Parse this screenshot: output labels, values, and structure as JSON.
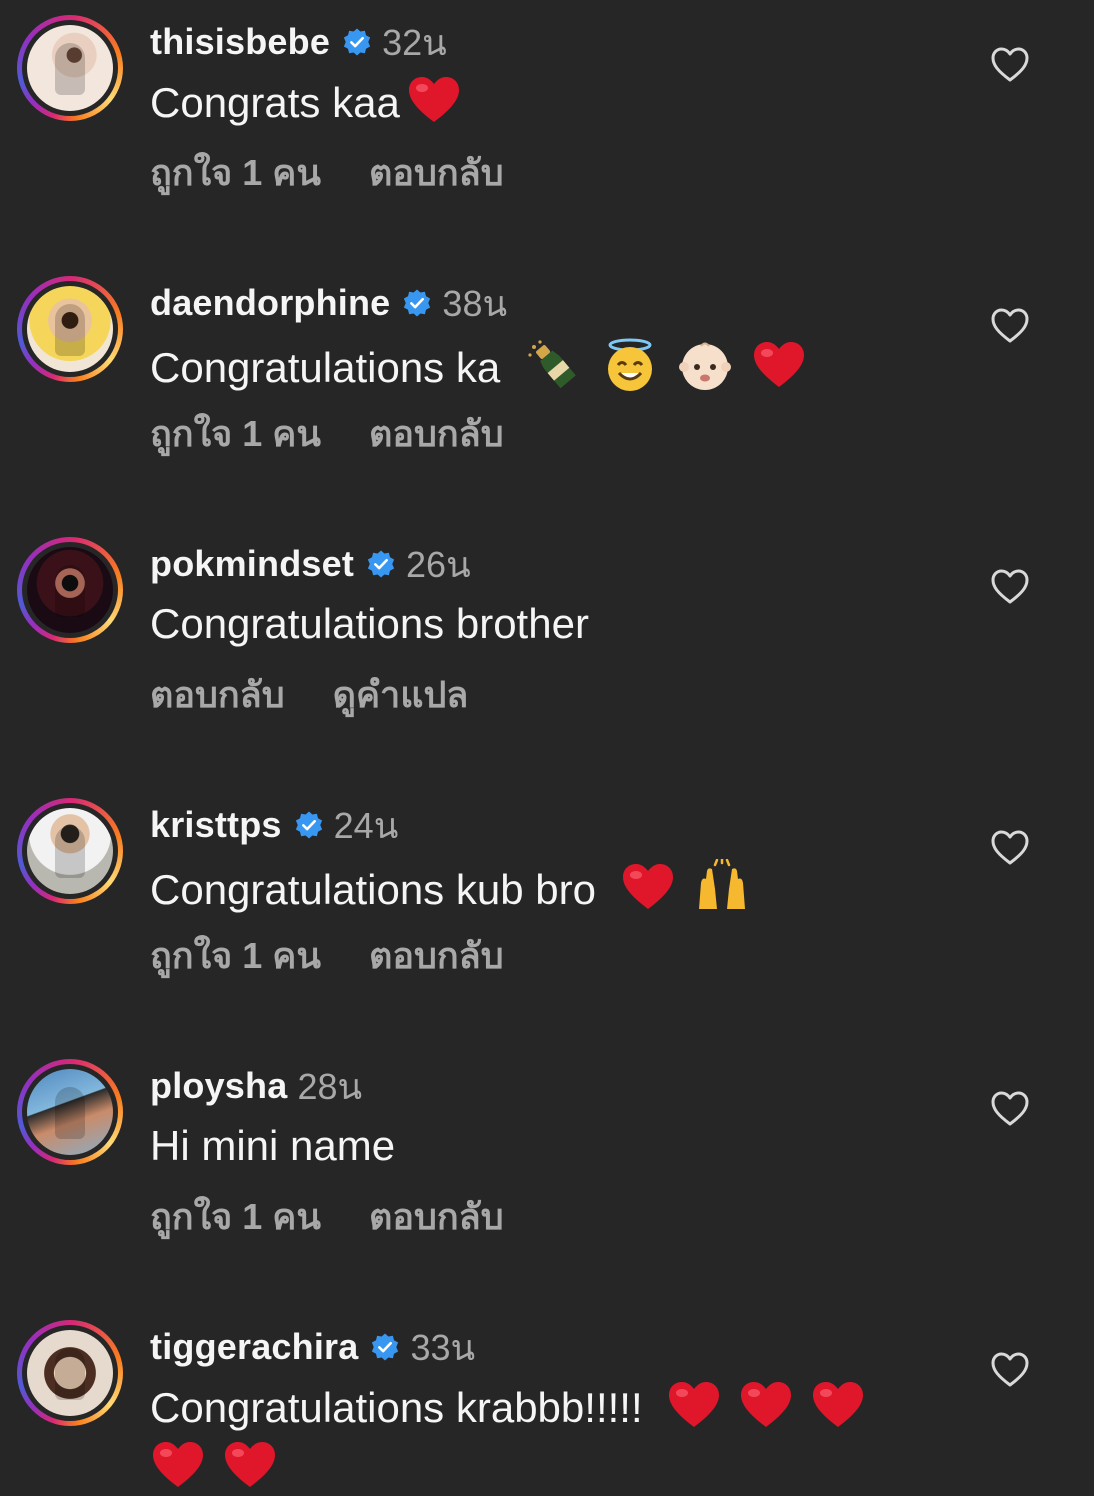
{
  "colors": {
    "background": "#262626",
    "primary_text": "#f5f5f5",
    "secondary_text": "#a8a8a8",
    "verified_blue": "#3897f0",
    "heart_red": "#e0162b"
  },
  "comments": [
    {
      "username": "thisisbebe",
      "verified": true,
      "time": "32น",
      "text": "Congrats kaa",
      "emojis": [
        "red-heart"
      ],
      "actions": [
        "ถูกใจ 1 คน",
        "ตอบกลับ"
      ]
    },
    {
      "username": "daendorphine",
      "verified": true,
      "time": "38น",
      "text": "Congratulations ka",
      "emojis": [
        "champagne",
        "smiling-face-with-halo",
        "baby",
        "red-heart"
      ],
      "actions": [
        "ถูกใจ 1 คน",
        "ตอบกลับ"
      ]
    },
    {
      "username": "pokmindset",
      "verified": true,
      "time": "26น",
      "text": "Congratulations brother",
      "emojis": [],
      "actions": [
        "ตอบกลับ",
        "ดูคำแปล"
      ]
    },
    {
      "username": "kristtps",
      "verified": true,
      "time": "24น",
      "text": "Congratulations kub bro",
      "emojis": [
        "red-heart",
        "raising-hands"
      ],
      "actions": [
        "ถูกใจ 1 คน",
        "ตอบกลับ"
      ]
    },
    {
      "username": "ploysha",
      "verified": false,
      "time": "28น",
      "text": "Hi mini name",
      "emojis": [],
      "actions": [
        "ถูกใจ 1 คน",
        "ตอบกลับ"
      ]
    },
    {
      "username": "tiggerachira",
      "verified": true,
      "time": "33น",
      "text": "Congratulations krabbb!!!!!",
      "emojis": [
        "red-heart",
        "red-heart",
        "red-heart",
        "red-heart",
        "red-heart"
      ],
      "actions": []
    }
  ]
}
